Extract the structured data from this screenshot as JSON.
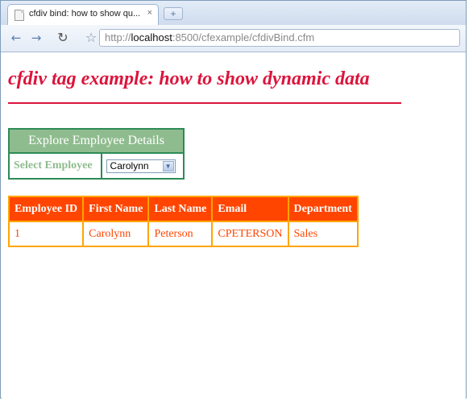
{
  "browser": {
    "tab_title": "cfdiv bind: how to show qu...",
    "tab_close": "×",
    "new_tab": "+",
    "url_prefix": "http://",
    "url_host": "localhost",
    "url_rest": ":8500/cfexample/cfdivBind.cfm"
  },
  "page": {
    "heading": "cfdiv tag example: how to show dynamic data",
    "explore": {
      "header": "Explore Employee Details",
      "label": "Select Employee",
      "selected": "Carolynn"
    },
    "table": {
      "columns": [
        "Employee ID",
        "First Name",
        "Last Name",
        "Email",
        "Department"
      ],
      "rows": [
        [
          "1",
          "Carolynn",
          "Peterson",
          "CPETERSON",
          "Sales"
        ]
      ]
    }
  },
  "colors": {
    "heading": "#dc143c",
    "explore_border": "#2e8b57",
    "explore_header_bg": "#8fbc8f",
    "table_header_bg": "#ff4500",
    "table_border": "#ffa500"
  }
}
